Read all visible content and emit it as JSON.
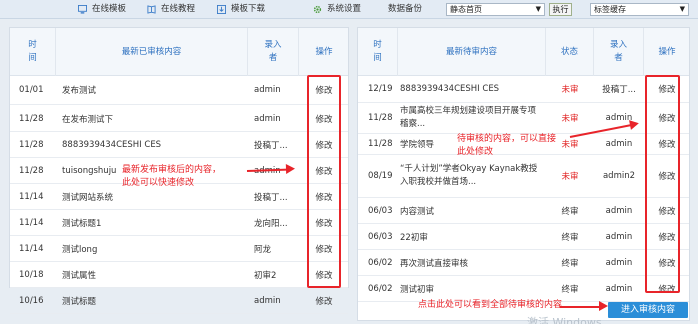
{
  "toolbar": {
    "items": [
      {
        "label": "在线模板",
        "icon": "monitor-icon"
      },
      {
        "label": "在线教程",
        "icon": "book-icon"
      },
      {
        "label": "模板下载",
        "icon": "download-icon"
      },
      {
        "label": "系统设置",
        "icon": "gear-icon"
      },
      {
        "label": "数据备份",
        "icon": ""
      }
    ],
    "page_select": "静态首页",
    "execute_label": "执行",
    "cache_select": "标签缓存"
  },
  "left_table": {
    "headers": [
      "时间",
      "最新已审核内容",
      "录入者",
      "操作"
    ],
    "rows": [
      {
        "time": "01/01",
        "title": "发布测试",
        "author": "admin",
        "action": "修改"
      },
      {
        "time": "11/28",
        "title": "在发布测试下",
        "author": "admin",
        "action": "修改"
      },
      {
        "time": "11/28",
        "title": "8883939434CESHI CES",
        "author": "投稿丁...",
        "action": "修改"
      },
      {
        "time": "11/28",
        "title": "tuisongshuju",
        "author": "admin",
        "action": "修改"
      },
      {
        "time": "11/14",
        "title": "测试网站系统",
        "author": "投稿丁...",
        "action": "修改"
      },
      {
        "time": "11/14",
        "title": "测试标题1",
        "author": "龙向阳...",
        "action": "修改"
      },
      {
        "time": "11/14",
        "title": "测试long",
        "author": "阿龙",
        "action": "修改"
      },
      {
        "time": "10/18",
        "title": "测试属性",
        "author": "初审2",
        "action": "修改"
      },
      {
        "time": "10/16",
        "title": "测试标题",
        "author": "admin",
        "action": "修改"
      }
    ]
  },
  "right_table": {
    "headers": [
      "时间",
      "最新待审内容",
      "状态",
      "录入者",
      "操作"
    ],
    "rows": [
      {
        "time": "12/19",
        "title": "8883939434CESHI CES",
        "status": "未审",
        "author": "投稿丁...",
        "action": "修改"
      },
      {
        "time": "11/28",
        "title": "市属高校三年规划建设项目开展专项稽察...",
        "status": "未审",
        "author": "admin",
        "action": "修改"
      },
      {
        "time": "11/28",
        "title": "学院领导",
        "status": "未审",
        "author": "admin",
        "action": "修改"
      },
      {
        "time": "08/19",
        "title": "“千人计划”学者Okyay Kaynak教授入职我校并做首场...",
        "status": "未审",
        "author": "admin2",
        "action": "修改"
      },
      {
        "time": "06/03",
        "title": "内容测试",
        "status": "终审",
        "author": "admin",
        "action": "修改"
      },
      {
        "time": "06/03",
        "title": "22初审",
        "status": "终审",
        "author": "admin",
        "action": "修改"
      },
      {
        "time": "06/02",
        "title": "再次测试直接审核",
        "status": "终审",
        "author": "admin",
        "action": "修改"
      },
      {
        "time": "06/02",
        "title": "测试初审",
        "status": "终审",
        "author": "admin",
        "action": "修改"
      }
    ]
  },
  "annotations": {
    "left_note": "最新发布审核后的内容，\n此处可以快速修改",
    "right_note": "待审核的内容，可以直接\n此处修改",
    "bottom_note": "点击此处可以看到全部待审核的内容"
  },
  "enter_button": "进入审核内容",
  "watermark": "激活 Windows",
  "colors": {
    "accent": "#2f72c0",
    "annotation": "#e8242a",
    "status_pending": "#e02020",
    "button": "#2b8ed8"
  }
}
